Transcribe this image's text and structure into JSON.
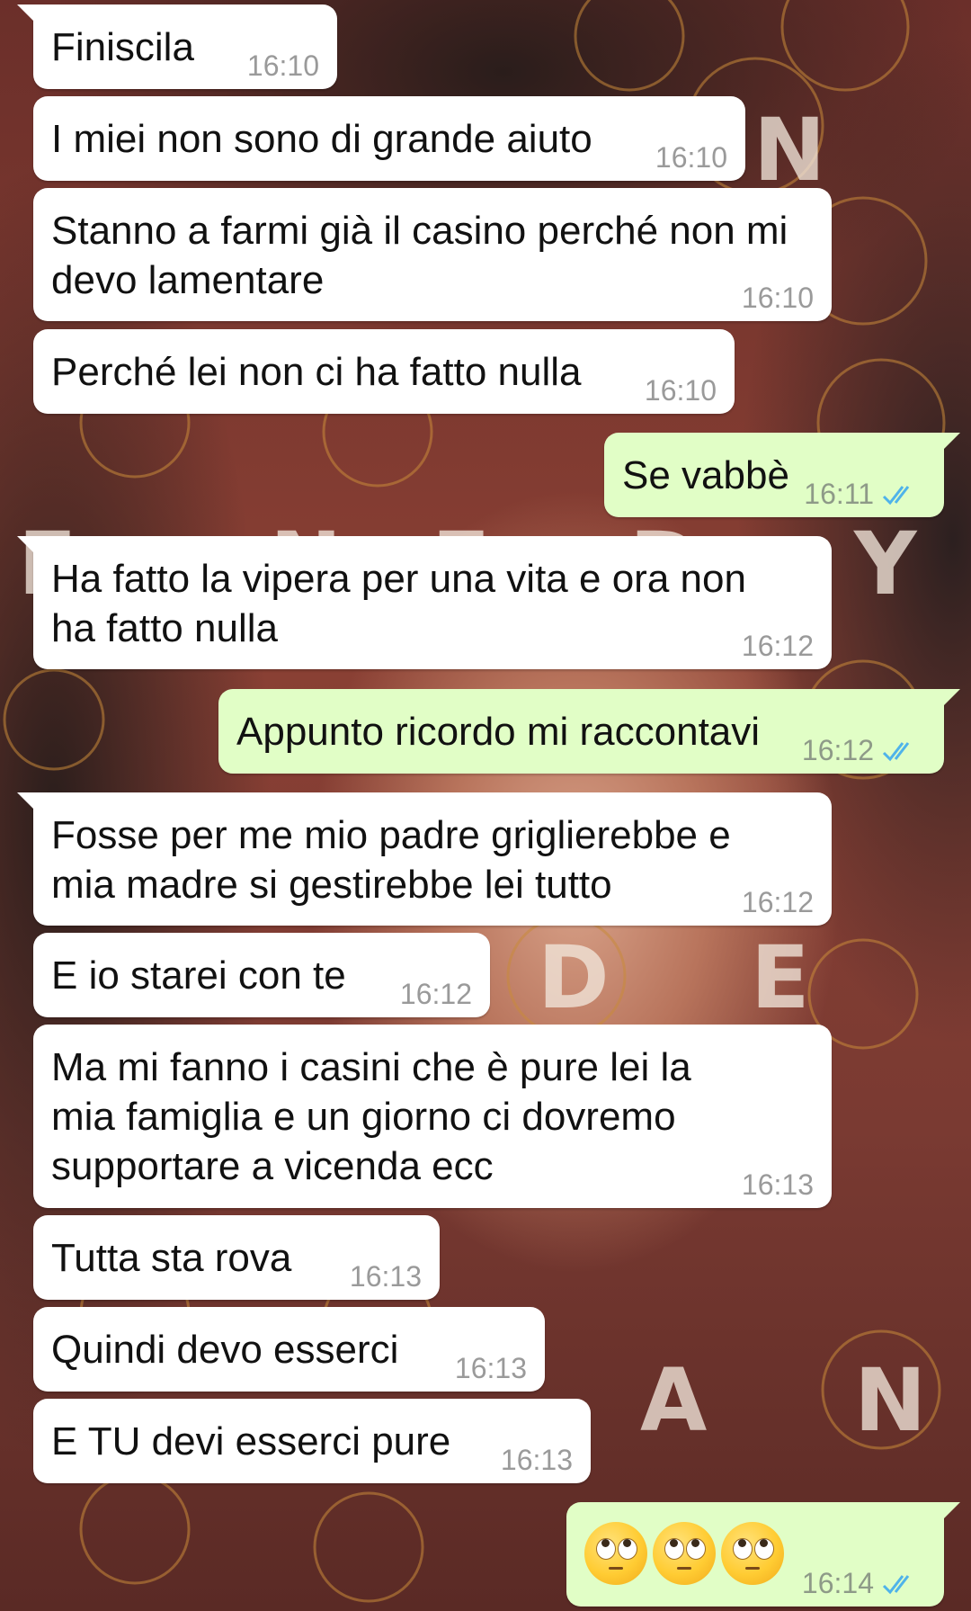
{
  "colors": {
    "incoming_bubble": "#ffffff",
    "outgoing_bubble": "#e1fec6",
    "timestamp": "#9a9a9a",
    "read_ticks": "#4fb3ea"
  },
  "wallpaper": {
    "letters": [
      "N",
      "Y",
      "D",
      "E",
      "A",
      "N",
      "E",
      "N",
      "E",
      "D"
    ]
  },
  "messages": [
    {
      "dir": "in",
      "text": "Finiscila",
      "time": "16:10"
    },
    {
      "dir": "in",
      "text": "I miei non sono di grande aiuto",
      "time": "16:10"
    },
    {
      "dir": "in",
      "lines": [
        "Stanno a farmi già il casino perché non mi",
        "devo lamentare"
      ],
      "time": "16:10"
    },
    {
      "dir": "in",
      "text": "Perché lei non ci ha fatto nulla",
      "time": "16:10"
    },
    {
      "dir": "out",
      "text": "Se vabbè",
      "time": "16:11",
      "status": "read"
    },
    {
      "dir": "in",
      "lines": [
        "Ha fatto la vipera per una vita e ora non",
        "ha fatto nulla"
      ],
      "time": "16:12"
    },
    {
      "dir": "out",
      "text": "Appunto ricordo mi raccontavi",
      "time": "16:12",
      "status": "read"
    },
    {
      "dir": "in",
      "lines": [
        "Fosse per me mio padre griglierebbe e",
        "mia madre si gestirebbe lei tutto"
      ],
      "time": "16:12"
    },
    {
      "dir": "in",
      "text": "E io starei con te",
      "time": "16:12"
    },
    {
      "dir": "in",
      "lines": [
        "Ma mi fanno i casini che è pure lei la",
        "mia famiglia e un giorno ci dovremo",
        "supportare a vicenda ecc"
      ],
      "time": "16:13"
    },
    {
      "dir": "in",
      "text": "Tutta sta rova",
      "time": "16:13"
    },
    {
      "dir": "in",
      "text": "Quindi devo esserci",
      "time": "16:13"
    },
    {
      "dir": "in",
      "text": "E TU devi esserci pure",
      "time": "16:13"
    },
    {
      "dir": "out",
      "emoji": [
        "face-with-rolling-eyes",
        "face-with-rolling-eyes",
        "face-with-rolling-eyes"
      ],
      "time": "16:14",
      "status": "read"
    }
  ]
}
